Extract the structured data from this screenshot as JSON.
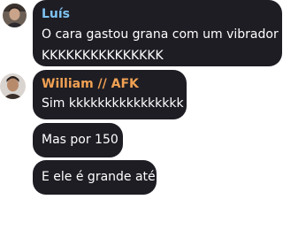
{
  "messages": [
    {
      "sender": "Luís",
      "sender_color": "#7ec3f2",
      "avatar": "user-avatar",
      "text_line1": "O cara gastou grana com um vibrador",
      "text_line2": "KKKKKKKKKKKKKKK"
    },
    {
      "sender": "William // AFK",
      "sender_color": "#f0a153",
      "avatar": "user-avatar",
      "text": "Sim kkkkkkkkkkkkkkkk"
    },
    {
      "text": "Mas por 150"
    },
    {
      "text": "E ele é grande até"
    }
  ],
  "colors": {
    "bubble": "#1e1d24",
    "text": "#ffffff",
    "background": "#ffffff"
  }
}
